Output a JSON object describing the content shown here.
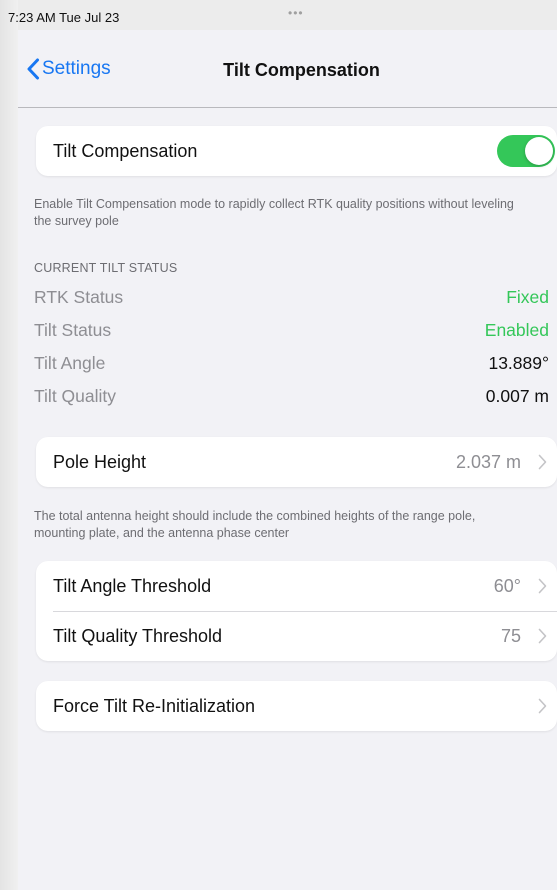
{
  "status_bar": {
    "time": "7:23 AM  Tue Jul 23",
    "dots": "•••"
  },
  "nav": {
    "back_label": "Settings",
    "title": "Tilt Compensation"
  },
  "tilt_toggle": {
    "label": "Tilt Compensation",
    "enabled": true
  },
  "tilt_footnote": "Enable Tilt Compensation mode to rapidly collect RTK quality positions without leveling the survey pole",
  "current_status": {
    "header": "CURRENT TILT STATUS",
    "rows": [
      {
        "label": "RTK Status",
        "value": "Fixed"
      },
      {
        "label": "Tilt Status",
        "value": "Enabled"
      },
      {
        "label": "Tilt Angle",
        "value": "13.889°"
      },
      {
        "label": "Tilt Quality",
        "value": "0.007 m"
      }
    ]
  },
  "pole_height": {
    "label": "Pole Height",
    "value": "2.037 m"
  },
  "pole_footnote": "The total antenna height should include the combined heights of the range pole, mounting plate, and the antenna phase center",
  "thresholds": [
    {
      "label": "Tilt Angle Threshold",
      "value": "60°"
    },
    {
      "label": "Tilt Quality Threshold",
      "value": "75"
    }
  ],
  "force_reinit": {
    "label": "Force Tilt Re-Initialization"
  },
  "colors": {
    "accent": "#1877f2",
    "green": "#34c759",
    "secondary_text": "#8e8e93"
  }
}
